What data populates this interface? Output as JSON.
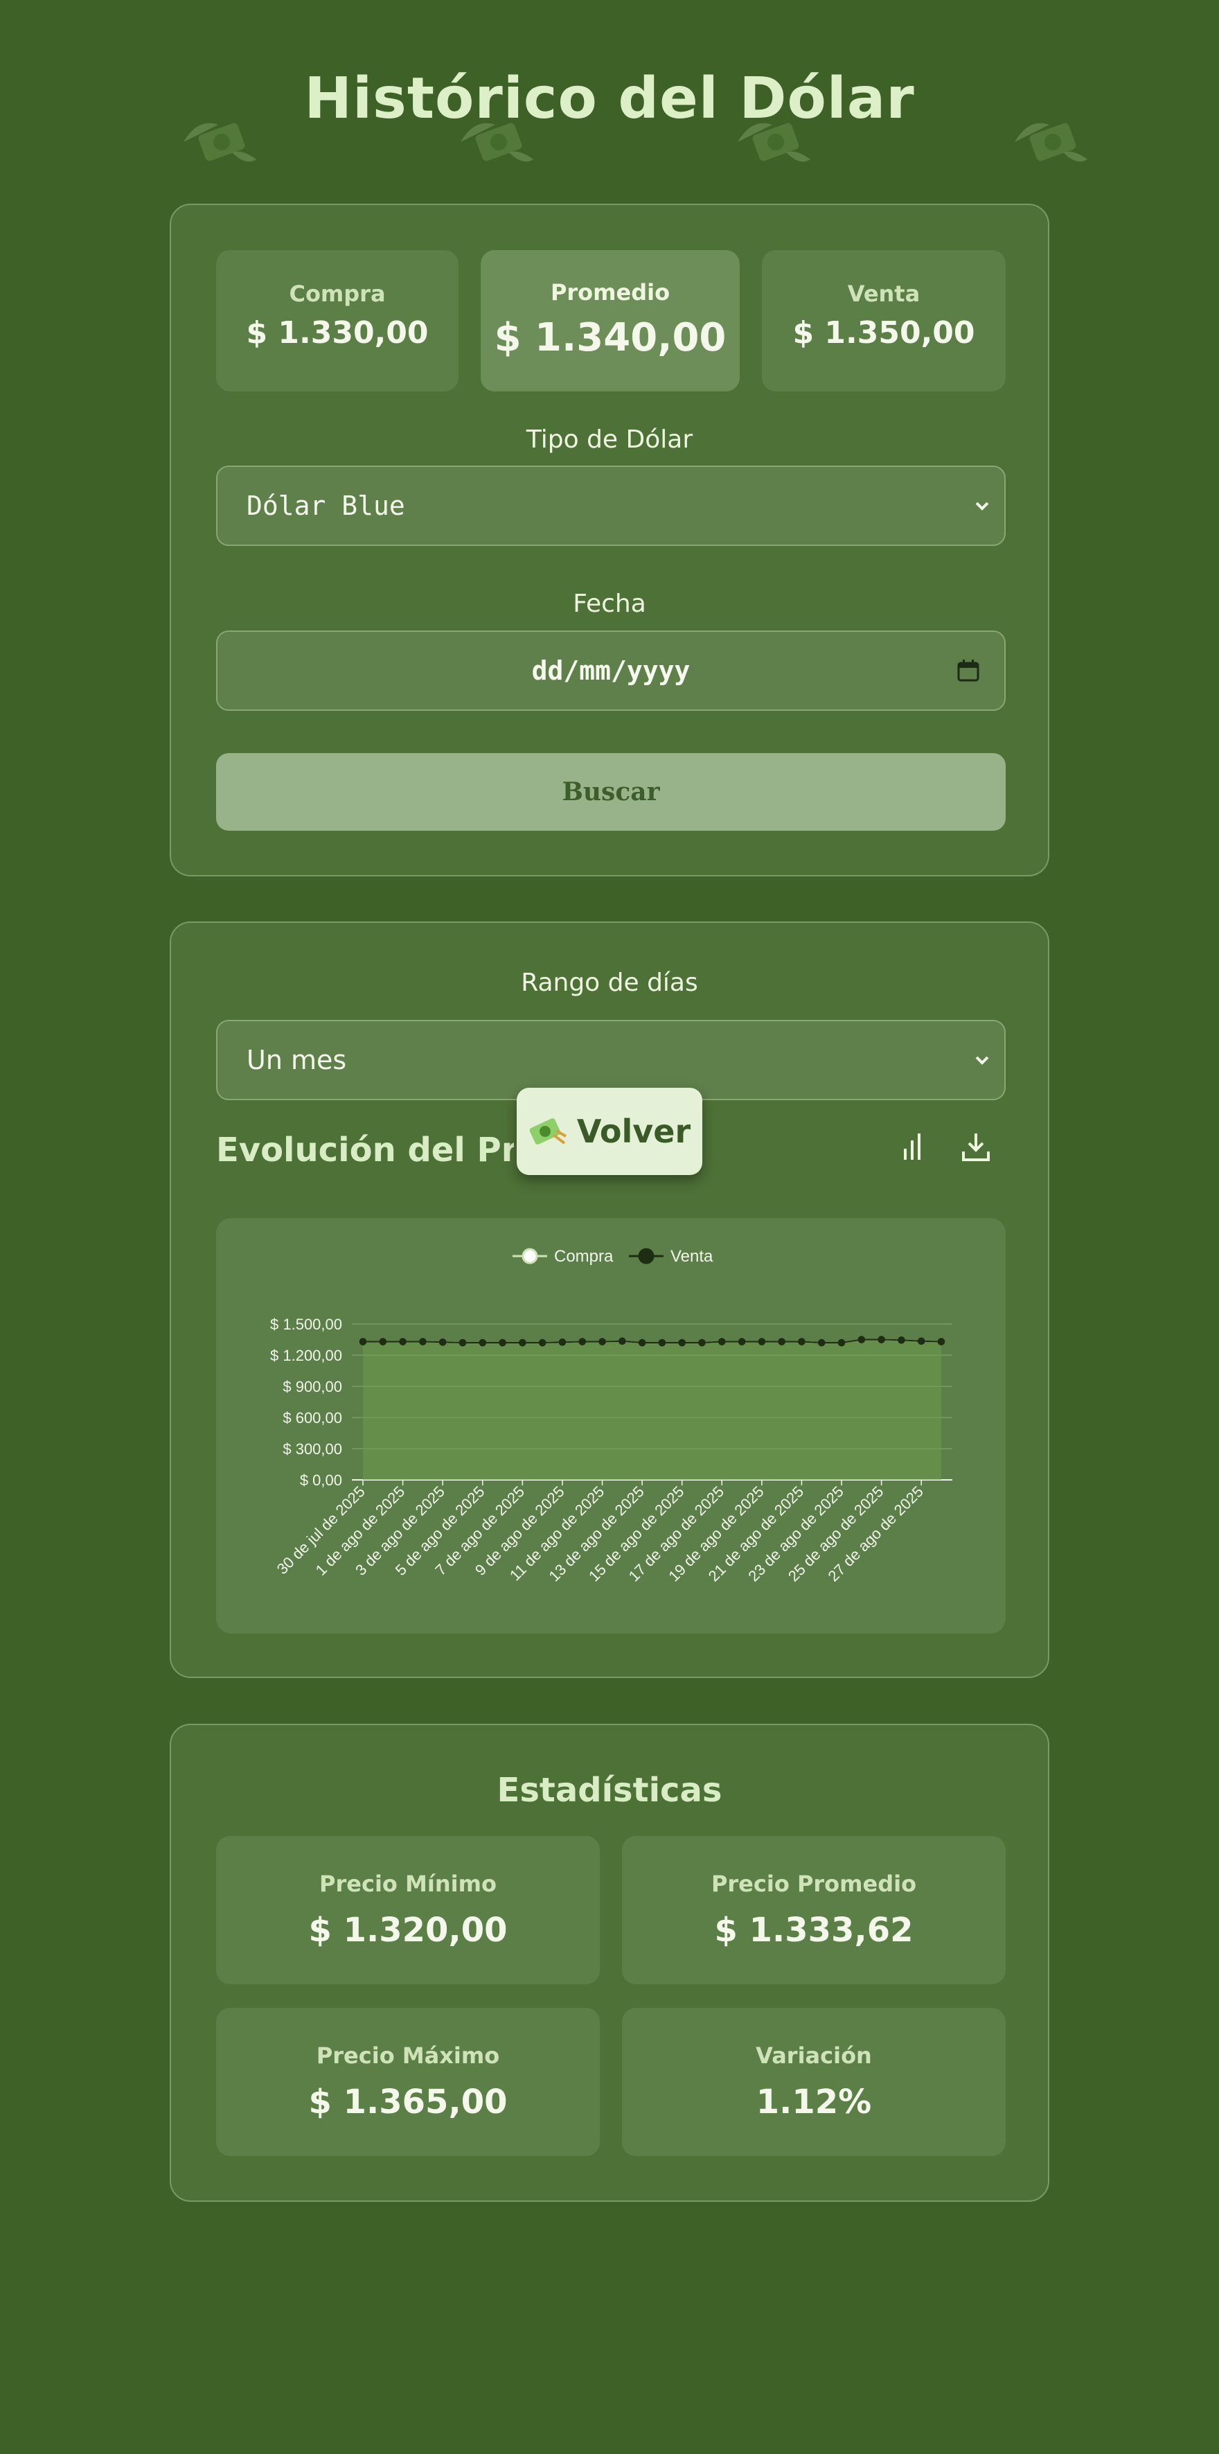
{
  "page": {
    "title": "Histórico del Dólar"
  },
  "quote": {
    "buy_label": "Compra",
    "buy_value": "$ 1.330,00",
    "avg_label": "Promedio",
    "avg_value": "$ 1.340,00",
    "sell_label": "Venta",
    "sell_value": "$ 1.350,00"
  },
  "filters": {
    "type_label": "Tipo de Dólar",
    "type_value": "Dólar Blue",
    "date_label": "Fecha",
    "date_placeholder": "dd/mm/yyyy",
    "search_label": "Buscar"
  },
  "evolution": {
    "range_label": "Rango de días",
    "range_value": "Un mes",
    "title": "Evolución del Precio",
    "back_label": "Volver",
    "icons": [
      "bar-chart-icon",
      "download-icon",
      "money-icon"
    ]
  },
  "chart_data": {
    "type": "line",
    "categories": [
      "30 de jul de 2025",
      "31 de jul de 2025",
      "1 de ago de 2025",
      "2 de ago de 2025",
      "3 de ago de 2025",
      "4 de ago de 2025",
      "5 de ago de 2025",
      "6 de ago de 2025",
      "7 de ago de 2025",
      "8 de ago de 2025",
      "9 de ago de 2025",
      "10 de ago de 2025",
      "11 de ago de 2025",
      "12 de ago de 2025",
      "13 de ago de 2025",
      "14 de ago de 2025",
      "15 de ago de 2025",
      "16 de ago de 2025",
      "17 de ago de 2025",
      "18 de ago de 2025",
      "19 de ago de 2025",
      "20 de ago de 2025",
      "21 de ago de 2025",
      "22 de ago de 2025",
      "23 de ago de 2025",
      "24 de ago de 2025",
      "25 de ago de 2025",
      "26 de ago de 2025",
      "27 de ago de 2025",
      "28 de ago de 2025"
    ],
    "tick_labels": [
      "30 de jul de 2025",
      "1 de ago de 2025",
      "3 de ago de 2025",
      "5 de ago de 2025",
      "7 de ago de 2025",
      "9 de ago de 2025",
      "11 de ago de 2025",
      "13 de ago de 2025",
      "15 de ago de 2025",
      "17 de ago de 2025",
      "19 de ago de 2025",
      "21 de ago de 2025",
      "23 de ago de 2025",
      "25 de ago de 2025",
      "27 de ago de 2025"
    ],
    "series": [
      {
        "name": "Compra",
        "color": "#ffffff",
        "values": [
          1330,
          1330,
          1330,
          1330,
          1325,
          1320,
          1320,
          1320,
          1320,
          1320,
          1325,
          1330,
          1330,
          1335,
          1320,
          1320,
          1320,
          1320,
          1330,
          1330,
          1330,
          1330,
          1330,
          1320,
          1320,
          1350,
          1350,
          1345,
          1335,
          1330
        ]
      },
      {
        "name": "Venta",
        "color": "#1e2e12",
        "values": [
          1330,
          1330,
          1330,
          1330,
          1325,
          1320,
          1320,
          1320,
          1320,
          1320,
          1325,
          1330,
          1330,
          1335,
          1320,
          1320,
          1320,
          1320,
          1330,
          1330,
          1330,
          1330,
          1330,
          1320,
          1320,
          1350,
          1350,
          1345,
          1335,
          1330
        ]
      }
    ],
    "y_ticks": [
      "$ 0,00",
      "$ 300,00",
      "$ 600,00",
      "$ 900,00",
      "$ 1.200,00",
      "$ 1.500,00"
    ],
    "ylim": [
      0,
      1500
    ],
    "grid": true,
    "legend": "top-center"
  },
  "stats": {
    "title": "Estadísticas",
    "min_label": "Precio Mínimo",
    "min_value": "$ 1.320,00",
    "avg_label": "Precio Promedio",
    "avg_value": "$ 1.333,62",
    "max_label": "Precio Máximo",
    "max_value": "$ 1.365,00",
    "var_label": "Variación",
    "var_value": "1.12%"
  }
}
